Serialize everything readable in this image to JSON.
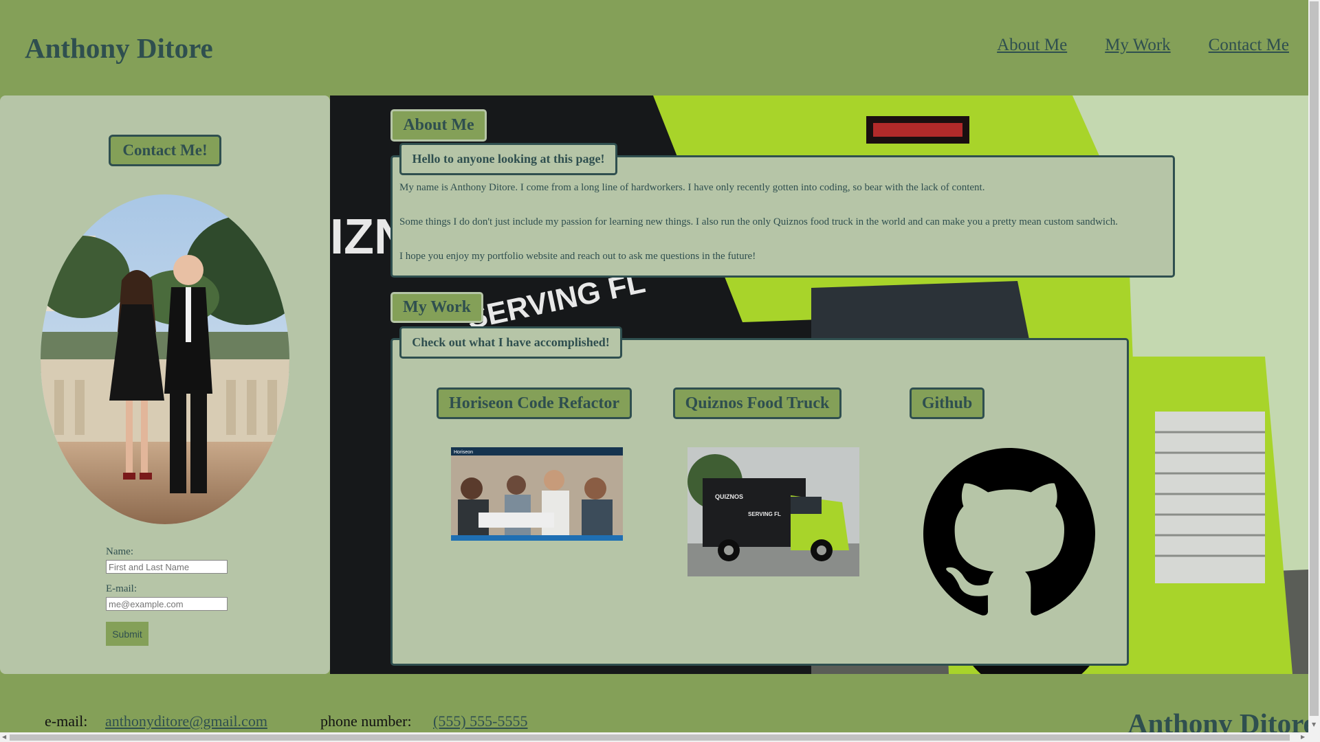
{
  "header": {
    "title": "Anthony Ditore",
    "nav": [
      "About Me",
      "My Work",
      "Contact Me"
    ]
  },
  "sidebar": {
    "contact_button": "Contact Me!",
    "form": {
      "name_label": "Name:",
      "name_placeholder": "First and Last Name",
      "email_label": "E-mail:",
      "email_placeholder": "me@example.com",
      "submit_label": "Submit"
    }
  },
  "about": {
    "section_title": "About Me",
    "heading": "Hello to anyone looking at this page!",
    "paragraphs": [
      "My name is Anthony Ditore. I come from a long line of hardworkers. I have only recently gotten into coding, so bear with the lack of content.",
      "Some things I do don't just include my passion for learning new things. I also run the only Quiznos food truck in the world and can make you a pretty mean custom sandwich.",
      "I hope you enjoy my portfolio website and reach out to ask me questions in the future!"
    ]
  },
  "work": {
    "section_title": "My Work",
    "heading": "Check out what I have accomplished!",
    "projects": [
      {
        "label": "Horiseon Code Refactor",
        "icon": "team-photo-thumbnail"
      },
      {
        "label": "Quiznos Food Truck",
        "icon": "food-truck-thumbnail"
      },
      {
        "label": "Github",
        "icon": "github-icon"
      }
    ],
    "thumb_text": {
      "horiseon_brand": "Horiseon",
      "truck_brand": "QUIZNOS",
      "truck_slogan": "SERVING FL"
    }
  },
  "footer": {
    "email_label": "e-mail:",
    "email": "anthonyditore@gmail.com",
    "phone_label": "phone number:",
    "phone": "(555) 555-5555",
    "brand": "Anthony Ditore"
  },
  "colors": {
    "accent": "#84a058",
    "panel": "#b6c5a7",
    "text": "#2f4f4f",
    "truck_green": "#a8d42a"
  }
}
